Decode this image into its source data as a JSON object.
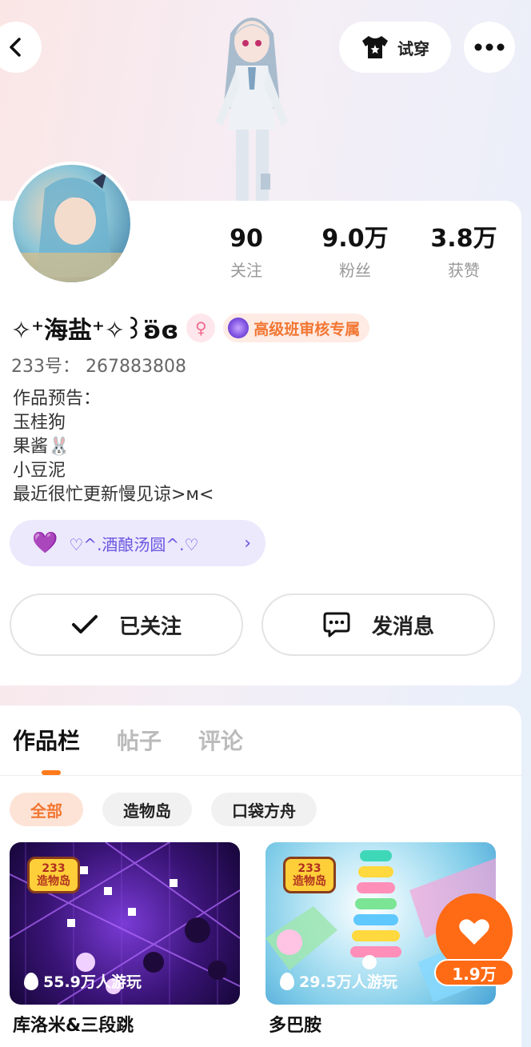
{
  "header": {
    "try_on_label": "试穿"
  },
  "profile": {
    "stats": [
      {
        "value": "90",
        "label": "关注"
      },
      {
        "value": "9.0万",
        "label": "粉丝"
      },
      {
        "value": "3.8万",
        "label": "获赞"
      }
    ],
    "name": "✧⁺海盐⁺✧꒱ʚ⃛ɞ",
    "gender_symbol": "♀",
    "rank_badge": "高级班审核专属",
    "id_text": "233号： 267883808",
    "bio_lines": [
      "作品预告：",
      "玉桂狗",
      "果酱🐰",
      "小豆泥",
      "最近很忙更新慢见谅>ᴍ<"
    ],
    "group_name": "♡^.酒酿汤圆^.♡",
    "follow_label": "已关注",
    "message_label": "发消息"
  },
  "content": {
    "tabs": [
      "作品栏",
      "帖子",
      "评论"
    ],
    "filters": [
      "全部",
      "造物岛",
      "口袋方舟"
    ],
    "logo_top": "233",
    "logo_bottom": "造物岛",
    "games": [
      {
        "title": "库洛米&三段跳",
        "plays": "55.9万人游玩"
      },
      {
        "title": "多巴胺",
        "plays": "29.5万人游玩"
      }
    ]
  },
  "like": {
    "count": "1.9万"
  },
  "colors": {
    "accent": "#ff6a14",
    "rank_text": "#f27632",
    "group_text": "#6a55e0"
  }
}
